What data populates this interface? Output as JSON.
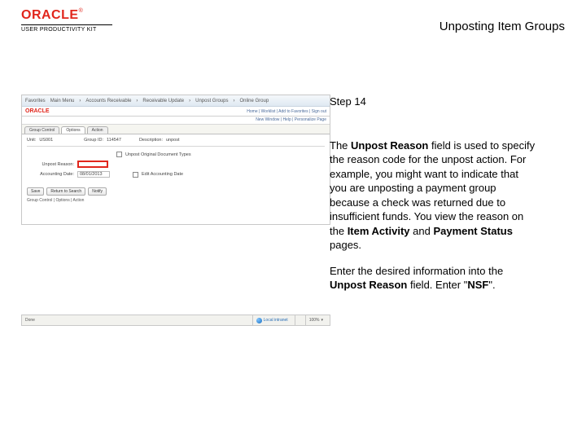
{
  "header": {
    "brand": "ORACLE",
    "tm": "®",
    "subtitle": "USER PRODUCTIVITY KIT",
    "title": "Unposting Item Groups"
  },
  "right": {
    "step": "Step 14",
    "para1_a": "The ",
    "para1_b": "Unpost Reason",
    "para1_c": " field is used to specify the reason code for the unpost action. For example, you might want to indicate that you are unposting a payment group because a check was returned due to insufficient funds. You view the reason on the ",
    "para1_d": "Item Activity",
    "para1_e": " and ",
    "para1_f": "Payment Status",
    "para1_g": " pages.",
    "para2_a": "Enter the desired information into the ",
    "para2_b": "Unpost Reason",
    "para2_c": " field. Enter \"",
    "para2_d": "NSF",
    "para2_e": "\"."
  },
  "shot": {
    "menu": [
      "Favorites",
      "Main Menu",
      "Accounts Receivable",
      "Receivable Update",
      "Unpost Groups",
      "Online Group"
    ],
    "oracle": "ORACLE",
    "links": "Home | Worklist | Add to Favorites | Sign out",
    "crumb": "New Window | Help | Personalize Page",
    "tabs": [
      "Group Control",
      "Options",
      "Action"
    ],
    "unit_lbl": "Unit:",
    "unit_val": "US001",
    "group_lbl": "Group ID:",
    "group_val": "114547",
    "desc_lbl": "Description:",
    "desc_val": "unpost",
    "chk1": "Unpost Original Document Types",
    "reason_lbl": "Unpost Reason:",
    "acct_lbl": "Accounting Date:",
    "acct_val": "08/01/2013",
    "chk2": "Edit Accounting Date",
    "btn_save": "Save",
    "btn_ret": "Return to Search",
    "btn_not": "Notify",
    "ref1": "Group Control",
    "ref2": "Options",
    "ref3": "Action"
  },
  "status": {
    "done": "Done",
    "zone": "Local intranet",
    "zoom": "100%"
  }
}
